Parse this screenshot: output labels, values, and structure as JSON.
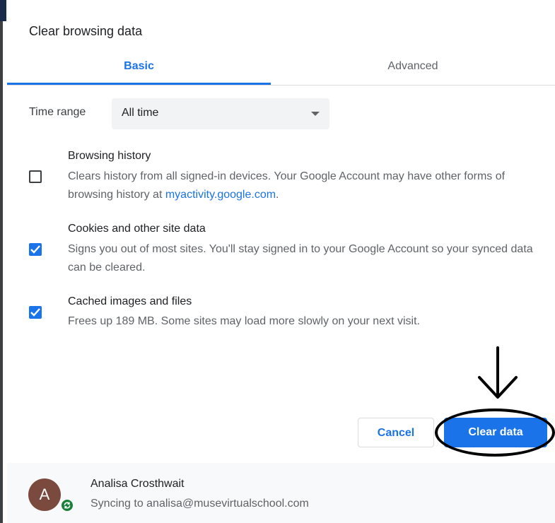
{
  "dialog": {
    "title": "Clear browsing data",
    "tabs": [
      {
        "label": "Basic",
        "active": true
      },
      {
        "label": "Advanced",
        "active": false
      }
    ],
    "time_range": {
      "label": "Time range",
      "value": "All time"
    },
    "options": [
      {
        "title": "Browsing history",
        "checked": false,
        "desc_before_link": "Clears history from all signed-in devices. Your Google Account may have other forms of browsing history at ",
        "link": "myactivity.google.com",
        "desc_after_link": "."
      },
      {
        "title": "Cookies and other site data",
        "checked": true,
        "desc": "Signs you out of most sites. You'll stay signed in to your Google Account so your synced data can be cleared."
      },
      {
        "title": "Cached images and files",
        "checked": true,
        "desc": "Frees up 189 MB. Some sites may load more slowly on your next visit."
      }
    ],
    "buttons": {
      "cancel": "Cancel",
      "clear": "Clear data"
    }
  },
  "footer": {
    "avatar_letter": "A",
    "user_name": "Analisa Crosthwait",
    "sync_status": "Syncing to analisa@musevirtualschool.com"
  },
  "colors": {
    "accent": "#1a73e8",
    "annotation": "#000000",
    "avatar": "#7b4a3f",
    "sync_badge": "#188038"
  },
  "icons": [
    "chevron-down-icon",
    "checkmark-icon",
    "sync-icon",
    "down-arrow-annotation"
  ]
}
